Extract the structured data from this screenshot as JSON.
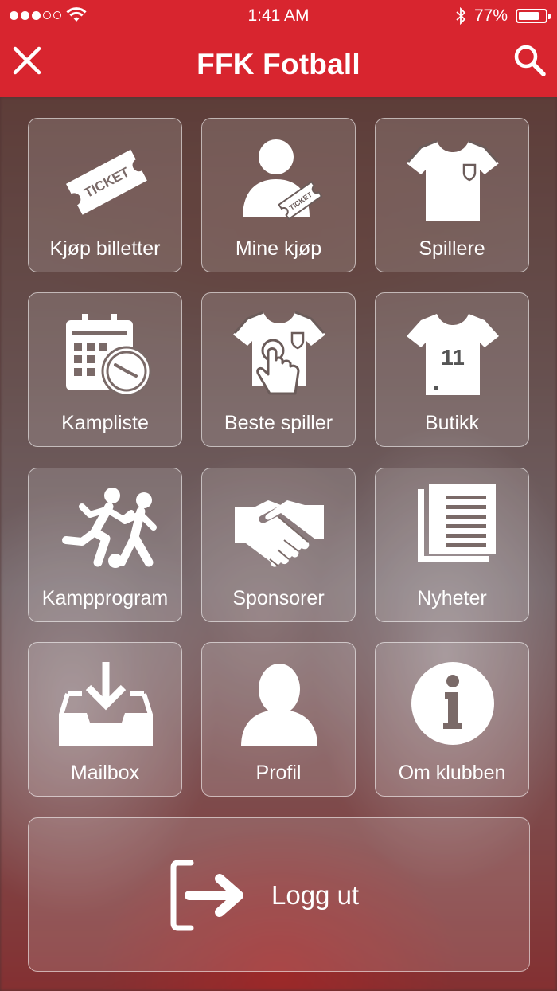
{
  "status_bar": {
    "time": "1:41 AM",
    "battery_percent": "77%",
    "battery_level": 0.77,
    "signal_dots_filled": 3,
    "signal_dots_total": 5
  },
  "navbar": {
    "title": "FFK Fotball",
    "close_icon": "close-icon",
    "search_icon": "search-icon"
  },
  "menu": {
    "items": [
      {
        "label": "Kjøp billetter",
        "icon": "ticket-icon"
      },
      {
        "label": "Mine kjøp",
        "icon": "person-ticket-icon"
      },
      {
        "label": "Spillere",
        "icon": "jersey-icon"
      },
      {
        "label": "Kampliste",
        "icon": "calendar-clock-icon"
      },
      {
        "label": "Beste spiller",
        "icon": "jersey-tap-icon"
      },
      {
        "label": "Butikk",
        "icon": "jersey-number-icon"
      },
      {
        "label": "Kampprogram",
        "icon": "players-icon"
      },
      {
        "label": "Sponsorer",
        "icon": "handshake-icon"
      },
      {
        "label": "Nyheter",
        "icon": "news-icon"
      },
      {
        "label": "Mailbox",
        "icon": "inbox-icon"
      },
      {
        "label": "Profil",
        "icon": "profile-icon"
      },
      {
        "label": "Om klubben",
        "icon": "info-icon"
      }
    ],
    "ticket_text": "TICKET",
    "jersey_number": "11",
    "logout_label": "Logg ut",
    "logout_icon": "logout-icon"
  },
  "colors": {
    "brand_red": "#d8252f"
  }
}
